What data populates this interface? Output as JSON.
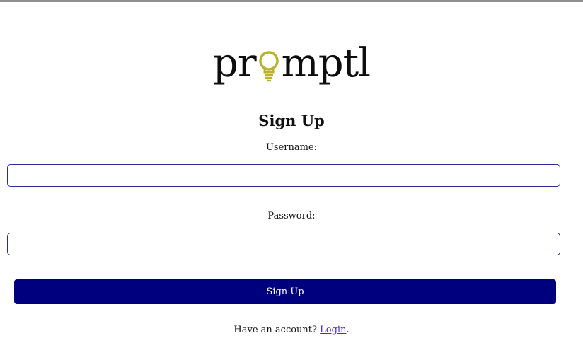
{
  "logo": {
    "text_before": "pr",
    "text_after": "mptl",
    "bulb_color": "#b9b22a"
  },
  "form": {
    "title": "Sign Up",
    "username_label": "Username:",
    "username_value": "",
    "password_label": "Password:",
    "password_value": "",
    "submit_label": "Sign Up"
  },
  "footer": {
    "prompt": "Have an account?",
    "link_label": "Login",
    "suffix": "."
  },
  "colors": {
    "button_bg": "#00007f",
    "input_border": "#2a2a9a",
    "link": "#4b2ac8",
    "top_bar": "#8f8f8f"
  }
}
